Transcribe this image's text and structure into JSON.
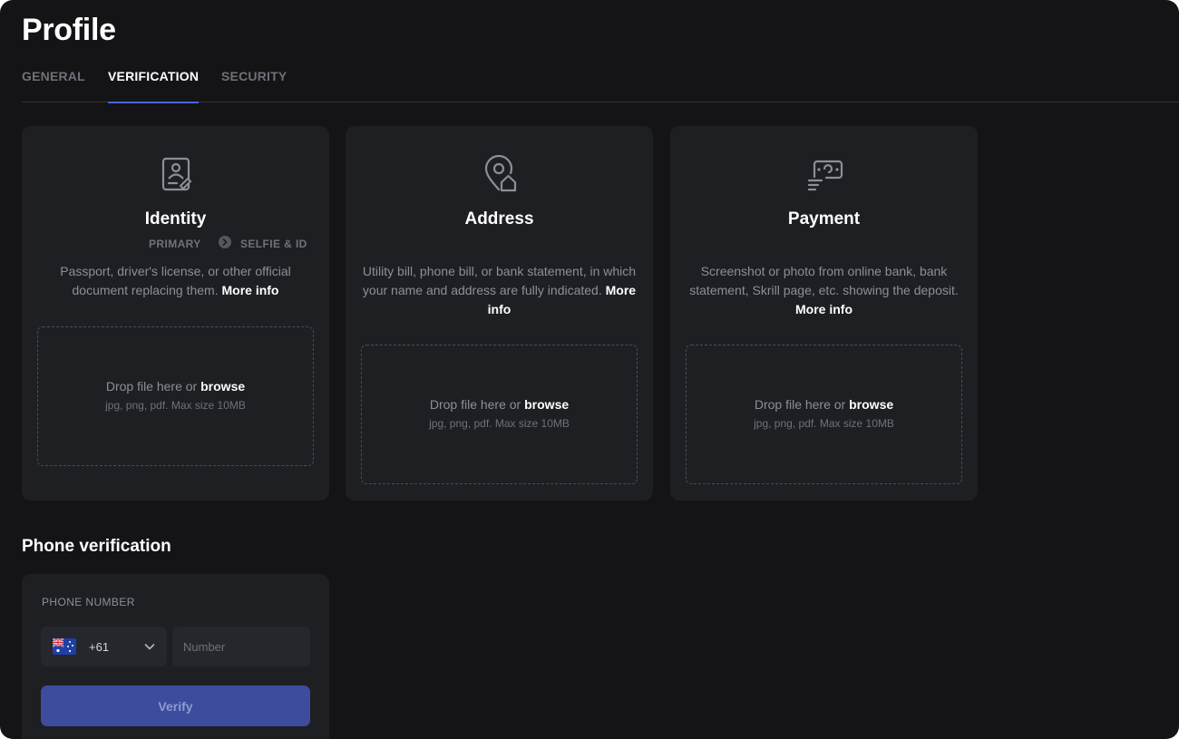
{
  "page": {
    "title": "Profile"
  },
  "tabs": [
    {
      "label": "GENERAL",
      "active": false
    },
    {
      "label": "VERIFICATION",
      "active": true
    },
    {
      "label": "SECURITY",
      "active": false
    }
  ],
  "accent_color": "#4a63d8",
  "cards": {
    "identity": {
      "icon": "id-card-icon",
      "title": "Identity",
      "step1": "PRIMARY",
      "step2": "SELFIE & ID",
      "desc": "Passport, driver's license, or other official document replacing them.",
      "more": "More info",
      "drop_text": "Drop file here or",
      "browse": "browse",
      "drop_hint": "jpg, png, pdf. Max size 10MB"
    },
    "address": {
      "icon": "location-home-icon",
      "title": "Address",
      "desc": "Utility bill, phone bill, or bank statement, in which your name and address are fully indicated.",
      "more": "More info",
      "drop_text": "Drop file here or",
      "browse": "browse",
      "drop_hint": "jpg, png, pdf. Max size 10MB"
    },
    "payment": {
      "icon": "payment-icon",
      "title": "Payment",
      "desc": "Screenshot or photo from online bank, bank statement, Skrill page, etc. showing the deposit.",
      "more": "More info",
      "drop_text": "Drop file here or",
      "browse": "browse",
      "drop_hint": "jpg, png, pdf. Max size 10MB"
    }
  },
  "phone": {
    "section_title": "Phone verification",
    "label": "PHONE NUMBER",
    "country_flag": "australia-flag-icon",
    "country_code": "+61",
    "number_value": "",
    "number_placeholder": "Number",
    "verify_label": "Verify"
  }
}
